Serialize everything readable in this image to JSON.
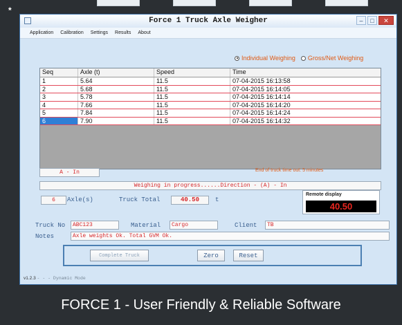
{
  "window": {
    "title": "Force 1 Truck Axle Weigher",
    "buttons": {
      "minimize": "–",
      "maximize": "□",
      "close": "✕"
    }
  },
  "menu": [
    "Application",
    "Calibration",
    "Settings",
    "Results",
    "About"
  ],
  "mode": {
    "individual_label": "Individual Weighing",
    "gross_label": "Gross/Net Weighing",
    "selected": "individual"
  },
  "table": {
    "columns": [
      "Seq",
      "Axle (t)",
      "Speed",
      "Time"
    ],
    "rows": [
      [
        "1",
        "5.64",
        "11.5",
        "07-04-2015 16:13:58"
      ],
      [
        "2",
        "5.68",
        "11.5",
        "07-04-2015 16:14:05"
      ],
      [
        "3",
        "5.78",
        "11.5",
        "07-04-2015 16:14:14"
      ],
      [
        "4",
        "7.66",
        "11.5",
        "07-04-2015 16:14:20"
      ],
      [
        "5",
        "7.84",
        "11.5",
        "07-04-2015 16:14:24"
      ],
      [
        "6",
        "7.90",
        "11.5",
        "07-04-2015 16:14:32"
      ]
    ],
    "selected_row": 6
  },
  "direction": "A - In",
  "timeout_text": "End of truck time out: 5 minutes",
  "progress_text": "Weighing in progress......Direction - (A) - In",
  "axle_count": "6",
  "axle_label": "Axle(s)",
  "truck_total_label": "Truck Total",
  "truck_total_value": "40.50",
  "truck_total_unit": "t",
  "remote": {
    "label": "Remote display",
    "value": "40.50"
  },
  "fields": {
    "truck_no_label": "Truck No",
    "truck_no_value": "ABC123",
    "material_label": "Material",
    "material_value": "Cargo",
    "client_label": "Client",
    "client_value": "TB",
    "notes_label": "Notes",
    "notes_value": "Axle weights Ok.  Total GVM Ok."
  },
  "actions": {
    "complete": "Complete Truck",
    "zero": "Zero",
    "reset": "Reset"
  },
  "status": {
    "version": "v1.2.3",
    "mode": "- - - Dynamic Mode"
  },
  "caption": "FORCE 1 - User Friendly & Reliable Software",
  "colors": {
    "accent_orange": "#e05a14",
    "value_red": "#d6272a",
    "label_blue": "#3a5f8f",
    "window_bg": "#d4e5f5",
    "selection_blue": "#2f7fd6"
  }
}
